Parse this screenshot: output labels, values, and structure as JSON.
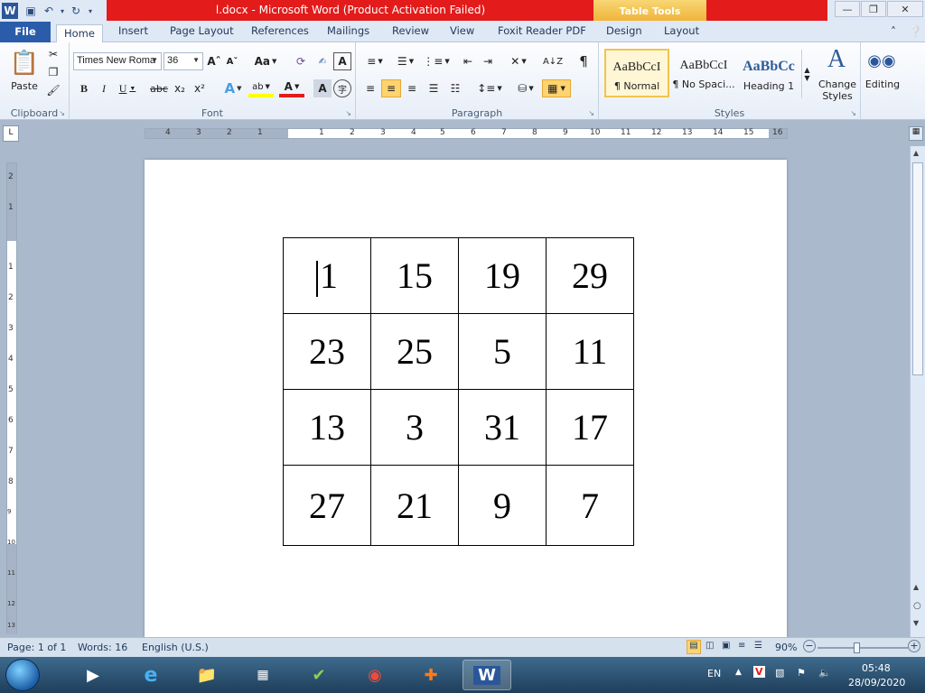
{
  "window": {
    "title": "l.docx - Microsoft Word (Product Activation Failed)",
    "table_tools": "Table Tools"
  },
  "tabs": [
    "File",
    "Home",
    "Insert",
    "Page Layout",
    "References",
    "Mailings",
    "Review",
    "View",
    "Foxit Reader PDF",
    "Design",
    "Layout"
  ],
  "ribbon": {
    "clipboard": {
      "paste": "Paste",
      "label": "Clipboard"
    },
    "font": {
      "family": "Times New Roma",
      "size": "36",
      "label": "Font",
      "case_btn": "Aa"
    },
    "paragraph": {
      "label": "Paragraph"
    },
    "styles": {
      "label": "Styles",
      "items": [
        {
          "sample": "AaBbCcI",
          "name": "¶ Normal"
        },
        {
          "sample": "AaBbCcI",
          "name": "¶ No Spaci..."
        },
        {
          "sample": "AaBbCc",
          "name": "Heading 1"
        }
      ],
      "change": "Change Styles"
    },
    "editing": {
      "label": "Editing"
    }
  },
  "ruler": {
    "left_numbers": [
      "4",
      "3",
      "2",
      "1"
    ],
    "right_numbers": [
      "1",
      "2",
      "3",
      "4",
      "5",
      "6",
      "7",
      "8",
      "9",
      "10",
      "11",
      "12",
      "13",
      "14",
      "15",
      "16"
    ],
    "vertical_numbers": [
      "2",
      "1",
      "1",
      "2",
      "3",
      "4",
      "5",
      "6",
      "7",
      "8",
      "9",
      "10",
      "11",
      "12",
      "13"
    ]
  },
  "document": {
    "table": [
      [
        "1",
        "15",
        "19",
        "29"
      ],
      [
        "23",
        "25",
        "5",
        "11"
      ],
      [
        "13",
        "3",
        "31",
        "17"
      ],
      [
        "27",
        "21",
        "9",
        "7"
      ]
    ]
  },
  "status": {
    "page": "Page: 1 of 1",
    "words": "Words: 16",
    "language": "English (U.S.)",
    "zoom": "90%"
  },
  "taskbar": {
    "lang": "EN",
    "time": "05:48",
    "date": "28/09/2020"
  }
}
